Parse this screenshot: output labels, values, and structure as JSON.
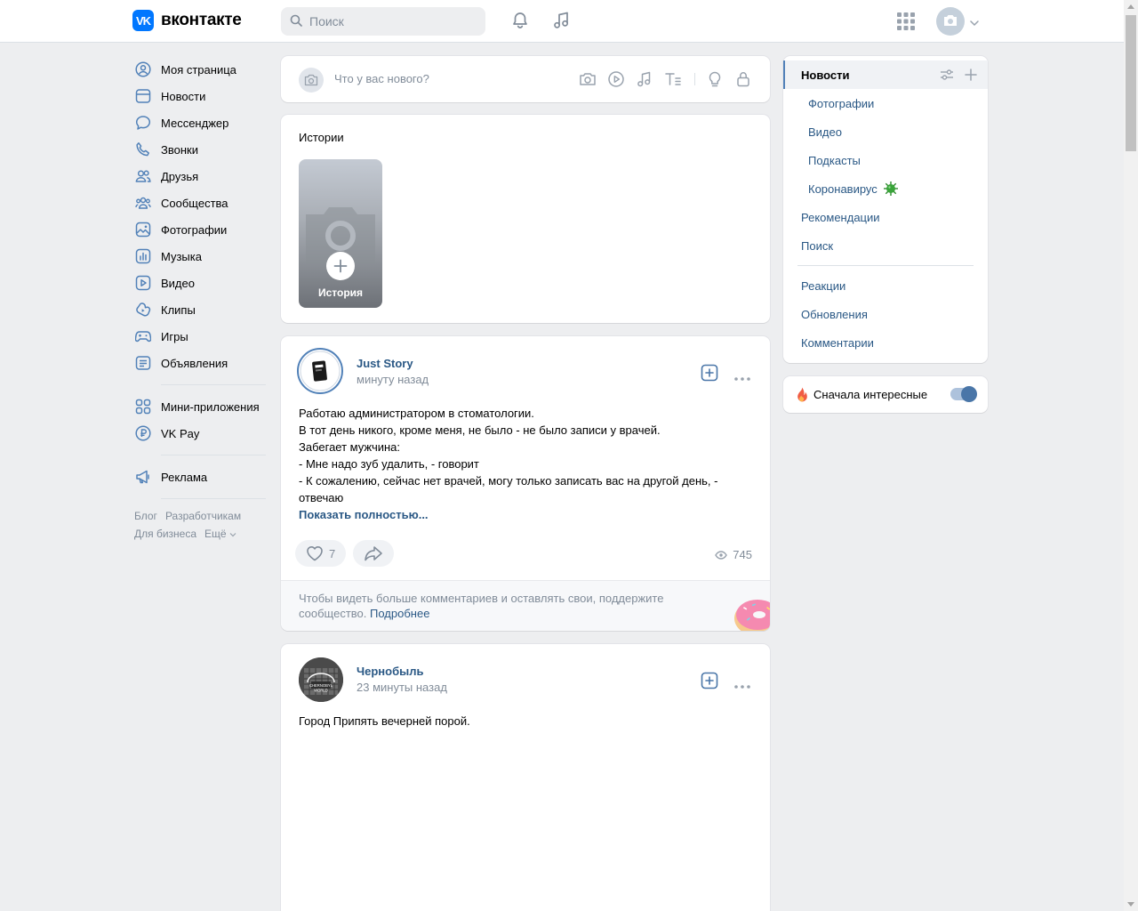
{
  "brand": {
    "logo_mark": "VK",
    "name": "вконтакте",
    "color": "#0077ff"
  },
  "header": {
    "search_placeholder": "Поиск",
    "icons": [
      "search-icon",
      "bell-icon",
      "music-icon",
      "apps-grid-icon",
      "camera-icon",
      "chevron-down-icon"
    ]
  },
  "sidebar": {
    "items": [
      {
        "label": "Моя страница",
        "icon": "user-circle-icon"
      },
      {
        "label": "Новости",
        "icon": "newsfeed-icon"
      },
      {
        "label": "Мессенджер",
        "icon": "message-icon"
      },
      {
        "label": "Звонки",
        "icon": "phone-icon"
      },
      {
        "label": "Друзья",
        "icon": "friends-icon"
      },
      {
        "label": "Сообщества",
        "icon": "communities-icon"
      },
      {
        "label": "Фотографии",
        "icon": "photo-icon"
      },
      {
        "label": "Музыка",
        "icon": "music-icon"
      },
      {
        "label": "Видео",
        "icon": "video-icon"
      },
      {
        "label": "Клипы",
        "icon": "clips-icon"
      },
      {
        "label": "Игры",
        "icon": "gamepad-icon"
      },
      {
        "label": "Объявления",
        "icon": "classifieds-icon"
      }
    ],
    "items2": [
      {
        "label": "Мини-приложения",
        "icon": "mini-apps-icon"
      },
      {
        "label": "VK Pay",
        "icon": "vkpay-icon"
      }
    ],
    "items3": [
      {
        "label": "Реклама",
        "icon": "megaphone-icon"
      }
    ],
    "footer": {
      "blog": "Блог",
      "devs": "Разработчикам",
      "business": "Для бизнеса",
      "more": "Ещё"
    }
  },
  "composer": {
    "placeholder": "Что у вас нового?"
  },
  "stories": {
    "title": "Истории",
    "add_label": "История"
  },
  "posts": [
    {
      "author": "Just Story",
      "time": "минуту назад",
      "lines": [
        "Работаю администратором в стоматологии.",
        "В тот день никого, кроме меня, не было - не было записи у врачей.",
        "Забегает мужчина:",
        "- Мне надо зуб удалить, - говорит",
        "- К сожалению, сейчас нет врачей, могу только записать вас на другой день, -",
        "отвечаю"
      ],
      "show_more": "Показать полностью...",
      "likes": "7",
      "views": "745",
      "comments_note": "Чтобы видеть больше комментариев и оставлять свои, поддержите сообщество.",
      "comments_link": "Подробнее"
    },
    {
      "author": "Чернобыль",
      "time": "23 минуты назад",
      "text": "Город Припять вечерней порой."
    }
  ],
  "right_menu": {
    "news": "Новости",
    "photos": "Фотографии",
    "video": "Видео",
    "podcasts": "Подкасты",
    "corona": "Коронавирус",
    "recommendations": "Рекомендации",
    "search": "Поиск",
    "reactions": "Реакции",
    "updates": "Обновления",
    "comments": "Комментарии"
  },
  "interesting_first": {
    "label": "Сначала интересные",
    "enabled": true
  },
  "colors": {
    "link": "#2a5885",
    "muted": "#818c99",
    "bg": "#edeef0",
    "accent": "#4a76a8"
  }
}
